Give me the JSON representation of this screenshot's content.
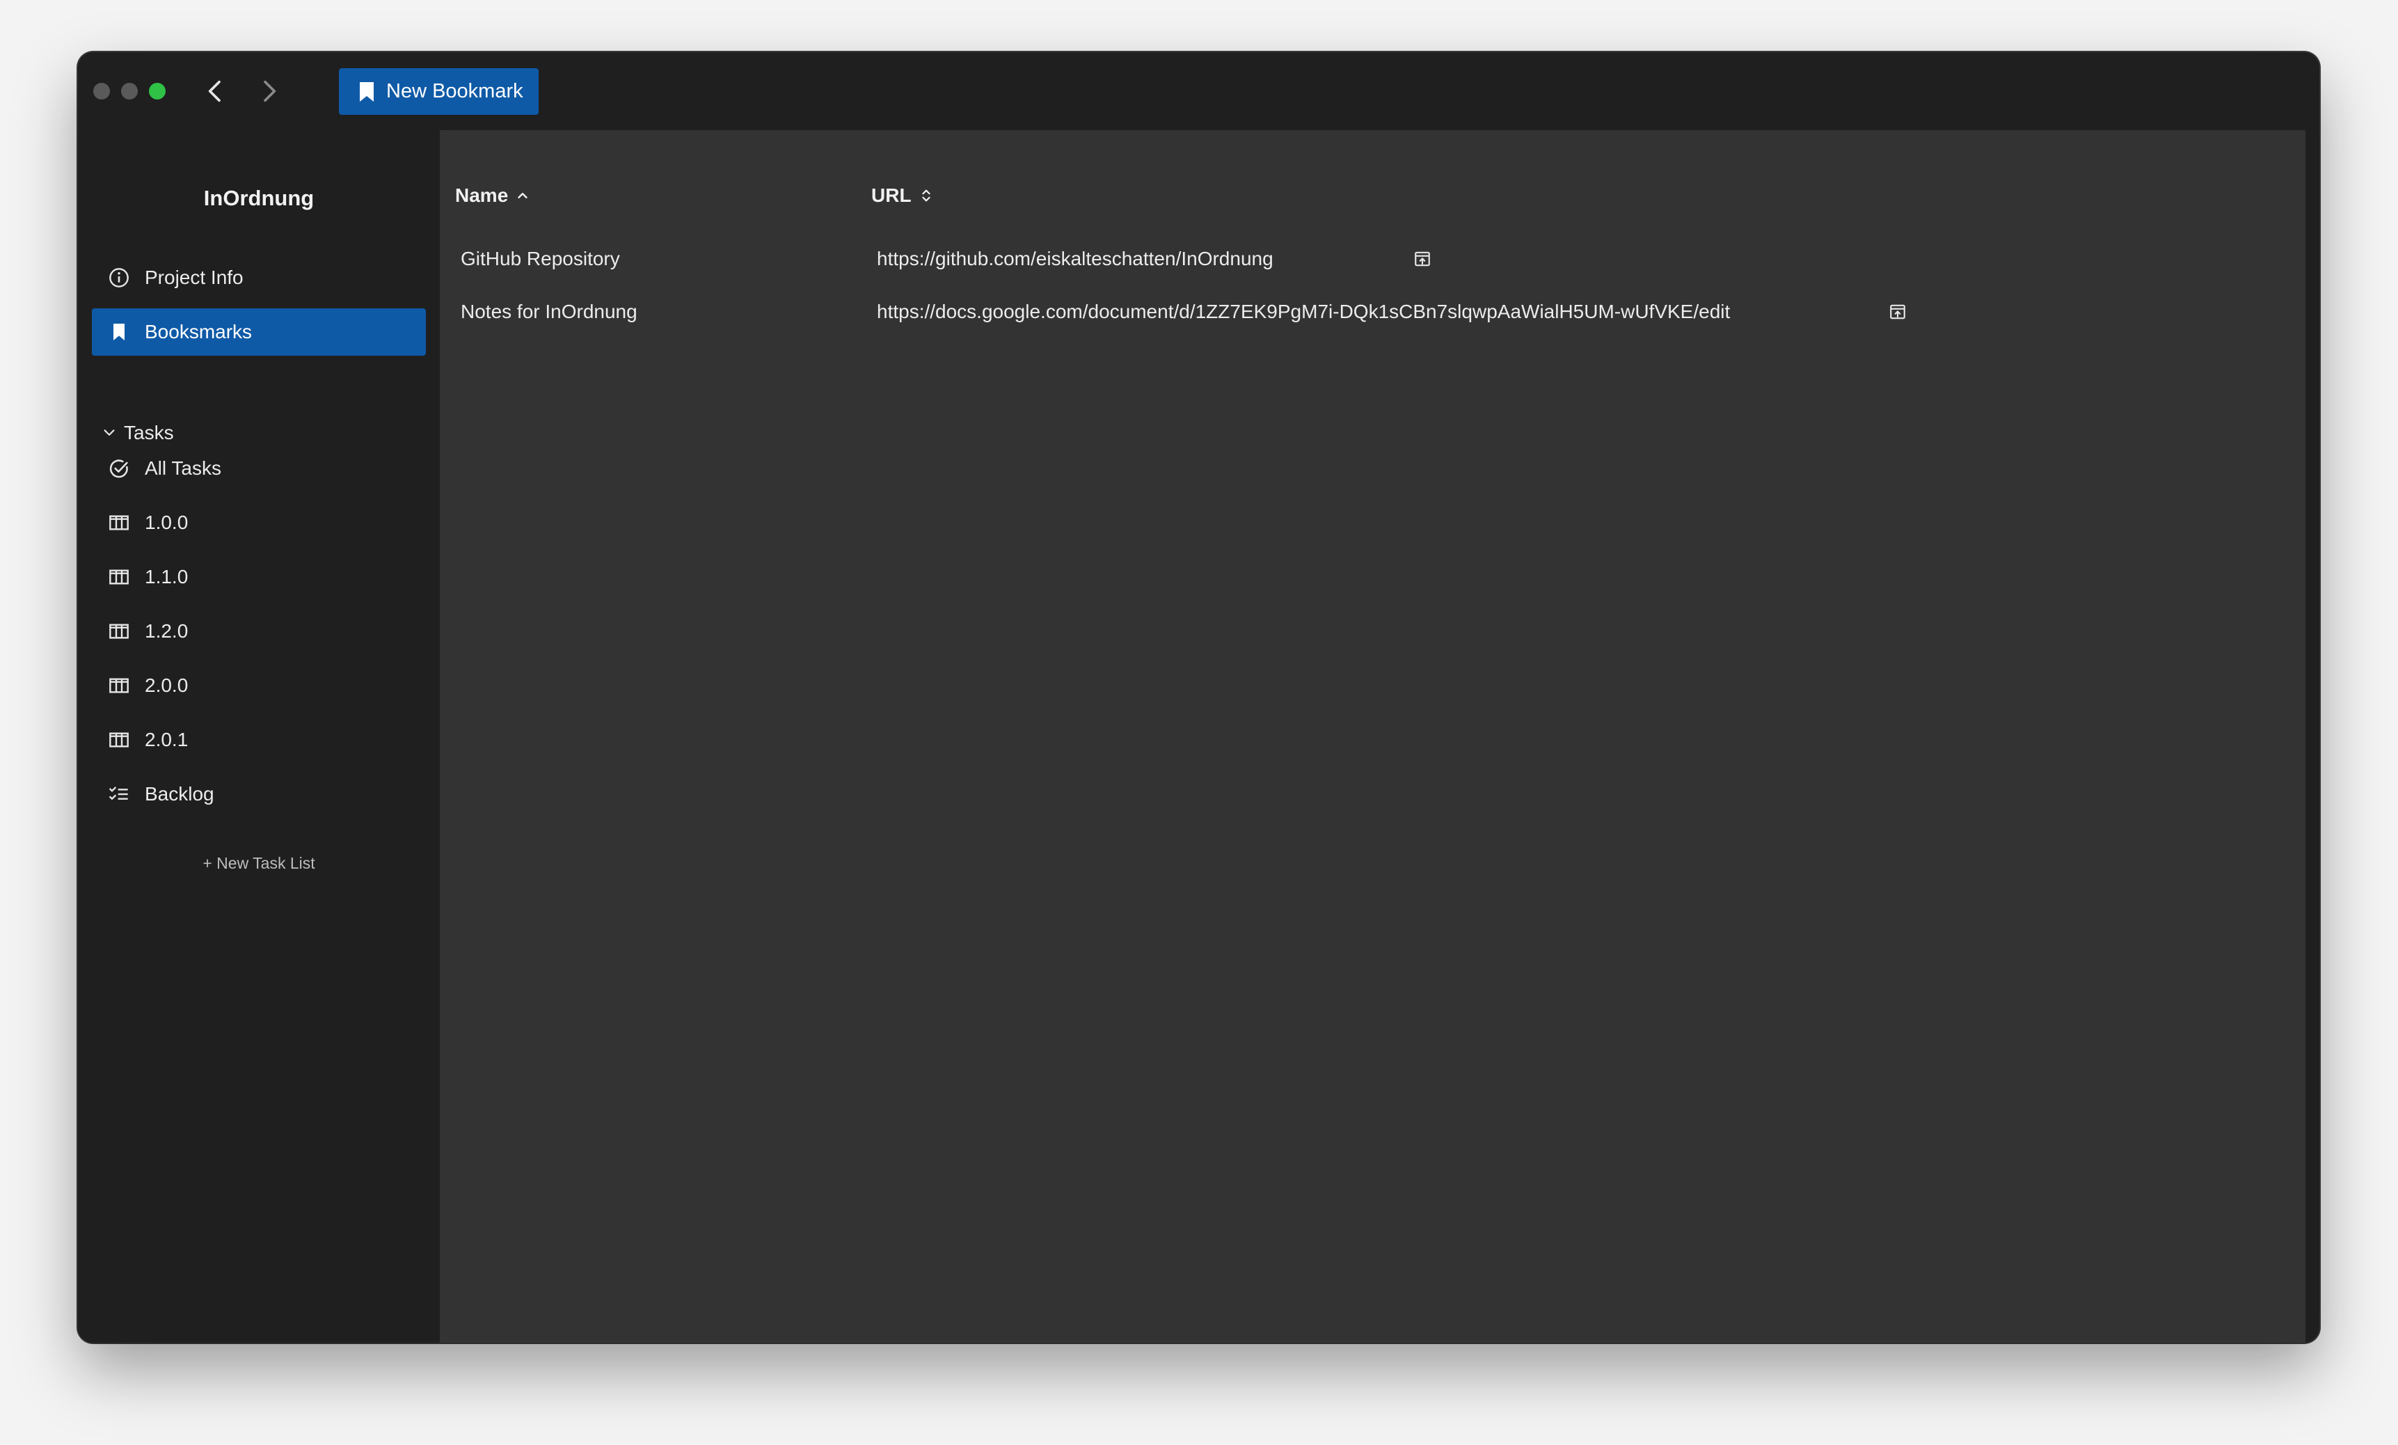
{
  "window": {
    "new_bookmark_label": "New Bookmark"
  },
  "sidebar": {
    "app_title": "InOrdnung",
    "project_info": "Project Info",
    "bookmarks": "Booksmarks",
    "tasks_section": "Tasks",
    "task_items": [
      {
        "label": "All Tasks",
        "icon": "check-circle-icon"
      },
      {
        "label": "1.0.0",
        "icon": "columns-icon"
      },
      {
        "label": "1.1.0",
        "icon": "columns-icon"
      },
      {
        "label": "1.2.0",
        "icon": "columns-icon"
      },
      {
        "label": "2.0.0",
        "icon": "columns-icon"
      },
      {
        "label": "2.0.1",
        "icon": "columns-icon"
      },
      {
        "label": "Backlog",
        "icon": "checklist-icon"
      }
    ],
    "new_task_list": "+ New Task List"
  },
  "table": {
    "columns": [
      {
        "label": "Name",
        "sort": "ascending"
      },
      {
        "label": "URL",
        "sort": "none"
      }
    ],
    "rows": [
      {
        "name": "GitHub Repository",
        "url": "https://github.com/eiskalteschatten/InOrdnung"
      },
      {
        "name": "Notes for InOrdnung",
        "url": "https://docs.google.com/document/d/1ZZ7EK9PgM7i-DQk1sCBn7slqwpAaWialH5UM-wUfVKE/edit"
      }
    ]
  },
  "colors": {
    "accent": "#0f5aa7",
    "sidebar_bg": "#1f1f1f",
    "content_bg": "#333333",
    "maximize": "#2fc246"
  }
}
